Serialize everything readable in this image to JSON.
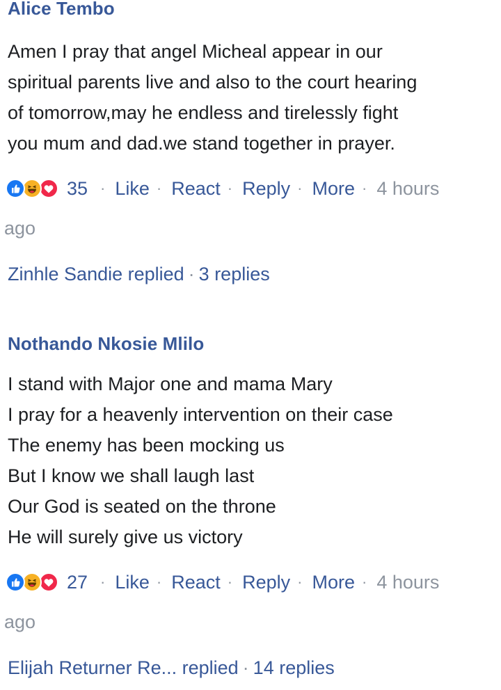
{
  "comments": [
    {
      "author": "Alice Tembo",
      "lines": [
        "Amen I pray that angel Micheal appear in our",
        "spiritual parents live and also to the court hearing",
        "of tomorrow,may  he endless and tirelessly fight",
        "you mum and dad.we  stand together in prayer."
      ],
      "reaction_icons": [
        "like-icon",
        "haha-icon",
        "love-icon"
      ],
      "reaction_count": "35",
      "actions": {
        "like": "Like",
        "react": "React",
        "reply": "Reply",
        "more": "More"
      },
      "time_part1": "4 hours",
      "time_part2": "ago",
      "replies_preview": {
        "who": "Zinhle Sandie replied",
        "count": "3 replies"
      }
    },
    {
      "author": "Nothando Nkosie Mlilo",
      "lines": [
        "I stand with Major one and mama Mary",
        "I pray for a heavenly intervention on their case",
        "The enemy has been mocking us",
        "But I know we shall laugh last",
        "Our God is seated on the throne",
        "He will surely give us victory"
      ],
      "reaction_icons": [
        "like-icon",
        "haha-icon",
        "love-icon"
      ],
      "reaction_count": "27",
      "actions": {
        "like": "Like",
        "react": "React",
        "reply": "Reply",
        "more": "More"
      },
      "time_part1": "4 hours",
      "time_part2": "ago",
      "replies_preview": {
        "who": "Elijah Returner Re...  replied",
        "count": "14 replies"
      }
    }
  ],
  "colors": {
    "link": "#385898",
    "meta": "#8d949e",
    "text": "#1c1e21",
    "like": "#1877f2",
    "haha": "#f7b125",
    "love": "#f0284a"
  },
  "separator": "·"
}
